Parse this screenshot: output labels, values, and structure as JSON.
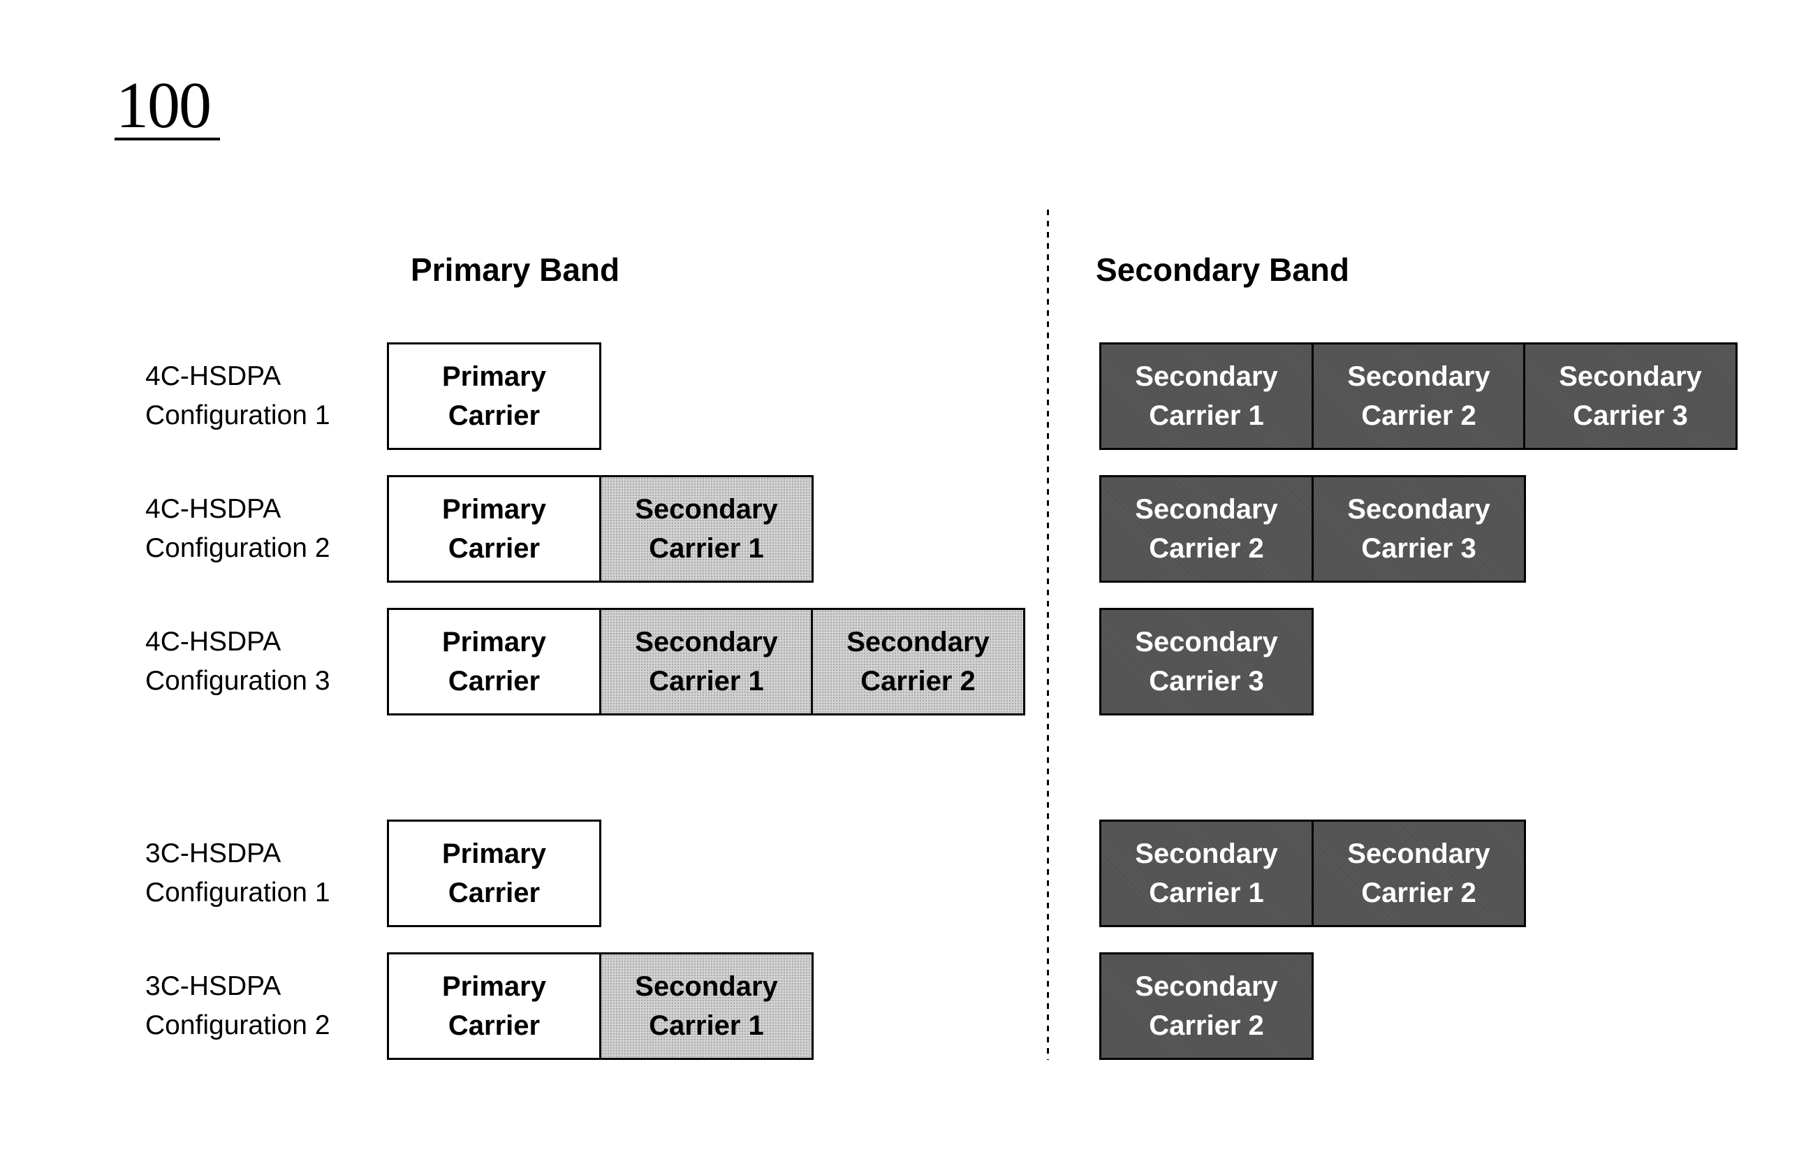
{
  "figure": {
    "number": "100"
  },
  "headers": {
    "primary_band": "Primary Band",
    "secondary_band": "Secondary Band"
  },
  "colors": {
    "primary_carrier_fill": "#ffffff",
    "primary_band_secondary_fill": "#d2d2d2",
    "secondary_band_fill": "#5a5a5a",
    "outline": "#000000"
  },
  "configurations": [
    {
      "label_line1": "4C-HSDPA",
      "label_line2": "Configuration 1",
      "primary_band": [
        {
          "type": "primary",
          "line1": "Primary",
          "line2": "Carrier"
        }
      ],
      "secondary_band": [
        {
          "type": "secondary",
          "line1": "Secondary",
          "line2": "Carrier 1"
        },
        {
          "type": "secondary",
          "line1": "Secondary",
          "line2": "Carrier 2"
        },
        {
          "type": "secondary",
          "line1": "Secondary",
          "line2": "Carrier 3"
        }
      ]
    },
    {
      "label_line1": "4C-HSDPA",
      "label_line2": "Configuration 2",
      "primary_band": [
        {
          "type": "primary",
          "line1": "Primary",
          "line2": "Carrier"
        },
        {
          "type": "secondary",
          "line1": "Secondary",
          "line2": "Carrier 1"
        }
      ],
      "secondary_band": [
        {
          "type": "secondary",
          "line1": "Secondary",
          "line2": "Carrier 2"
        },
        {
          "type": "secondary",
          "line1": "Secondary",
          "line2": "Carrier 3"
        }
      ]
    },
    {
      "label_line1": "4C-HSDPA",
      "label_line2": "Configuration 3",
      "primary_band": [
        {
          "type": "primary",
          "line1": "Primary",
          "line2": "Carrier"
        },
        {
          "type": "secondary",
          "line1": "Secondary",
          "line2": "Carrier 1"
        },
        {
          "type": "secondary",
          "line1": "Secondary",
          "line2": "Carrier 2"
        }
      ],
      "secondary_band": [
        {
          "type": "secondary",
          "line1": "Secondary",
          "line2": "Carrier 3"
        }
      ]
    },
    {
      "label_line1": "3C-HSDPA",
      "label_line2": "Configuration 1",
      "primary_band": [
        {
          "type": "primary",
          "line1": "Primary",
          "line2": "Carrier"
        }
      ],
      "secondary_band": [
        {
          "type": "secondary",
          "line1": "Secondary",
          "line2": "Carrier 1"
        },
        {
          "type": "secondary",
          "line1": "Secondary",
          "line2": "Carrier 2"
        }
      ]
    },
    {
      "label_line1": "3C-HSDPA",
      "label_line2": "Configuration 2",
      "primary_band": [
        {
          "type": "primary",
          "line1": "Primary",
          "line2": "Carrier"
        },
        {
          "type": "secondary",
          "line1": "Secondary",
          "line2": "Carrier 1"
        }
      ],
      "secondary_band": [
        {
          "type": "secondary",
          "line1": "Secondary",
          "line2": "Carrier 2"
        }
      ]
    }
  ]
}
